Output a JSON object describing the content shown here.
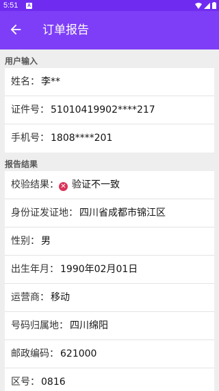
{
  "status_bar": {
    "time": "5:51",
    "notification_glyph": "A"
  },
  "app_bar": {
    "title": "订单报告"
  },
  "user_input": {
    "header": "用户输入",
    "rows": [
      {
        "label": "姓名：",
        "value": "李**"
      },
      {
        "label": "证件号：",
        "value": "51010419902****217"
      },
      {
        "label": "手机号：",
        "value": "1808****201"
      }
    ]
  },
  "report_result": {
    "header": "报告结果",
    "verify": {
      "label": "校验结果：",
      "value": "验证不一致",
      "icon": "fail-icon",
      "color": "#d9345a"
    },
    "rows": [
      {
        "label": "身份证发证地：",
        "value": "四川省成都市锦江区"
      },
      {
        "label": "性别：",
        "value": "男"
      },
      {
        "label": "出生年月：",
        "value": "1990年02月01日"
      },
      {
        "label": "运营商：",
        "value": "移动"
      },
      {
        "label": "号码归属地：",
        "value": "四川绵阳"
      },
      {
        "label": "邮政编码：",
        "value": "621000"
      },
      {
        "label": "区号：",
        "value": "0816"
      }
    ]
  },
  "colors": {
    "status_bar": "#6f2cf0",
    "app_bar": "#7e3ef7",
    "background": "#eeeeee"
  }
}
